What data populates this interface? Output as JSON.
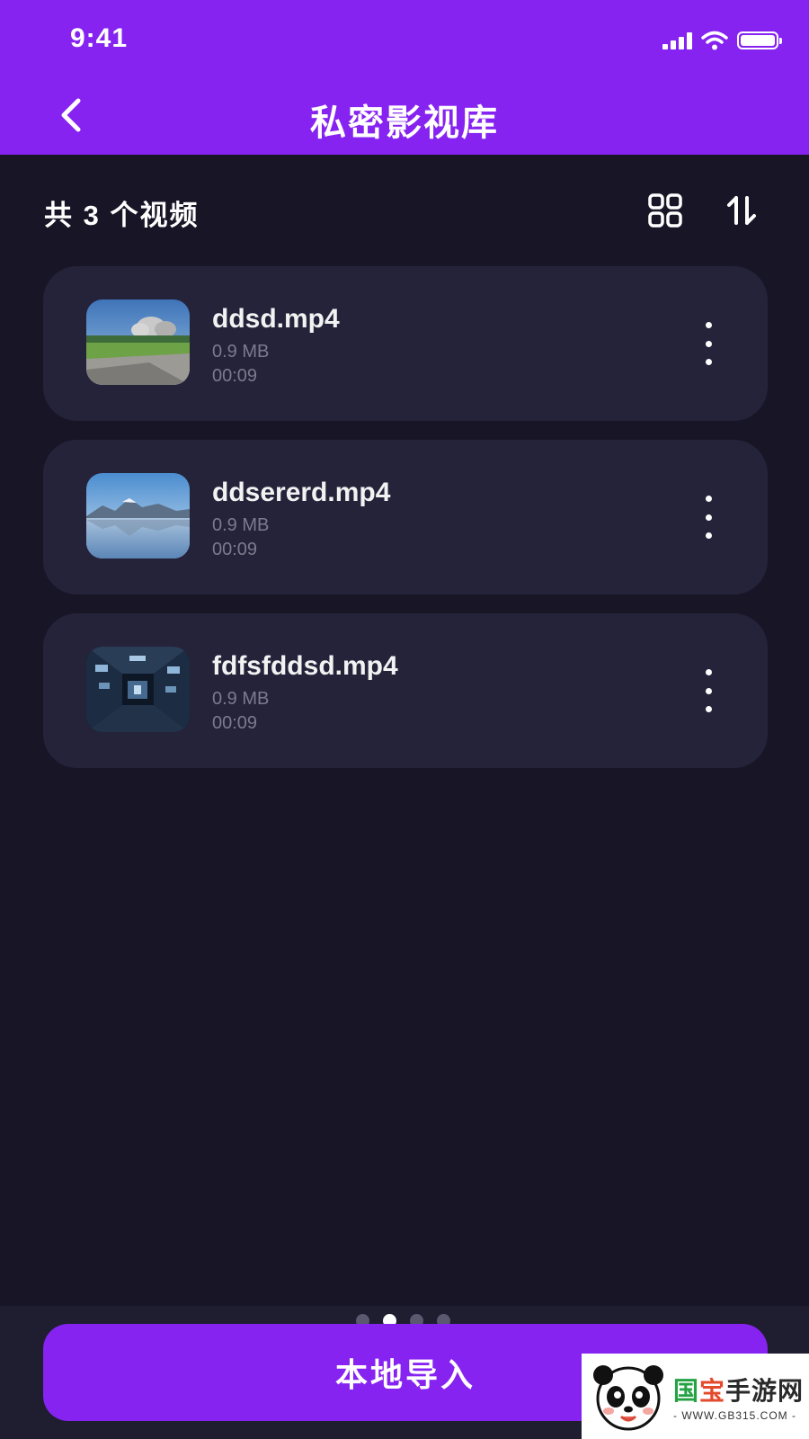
{
  "status_bar": {
    "time": "9:41"
  },
  "header": {
    "title": "私密影视库"
  },
  "toolbar": {
    "count_label": "共 3 个视频"
  },
  "videos": [
    {
      "name": "ddsd.mp4",
      "size": "0.9 MB",
      "duration": "00:09",
      "thumbnail": "stadium-landscape"
    },
    {
      "name": "ddsererd.mp4",
      "size": "0.9 MB",
      "duration": "00:09",
      "thumbnail": "mountain-lake"
    },
    {
      "name": "fdfsfddsd.mp4",
      "size": "0.9 MB",
      "duration": "00:09",
      "thumbnail": "futuristic-tunnel"
    }
  ],
  "pager": {
    "total": 4,
    "active": 2
  },
  "bottom": {
    "import_label": "本地导入"
  },
  "watermark": {
    "t1": "国",
    "t2": "宝",
    "t3": "手游网",
    "url": "- WWW.GB315.COM -"
  },
  "colors": {
    "accent": "#8623f0",
    "background": "#181626",
    "card": "#25233a",
    "muted_text": "#7c7a8c"
  }
}
